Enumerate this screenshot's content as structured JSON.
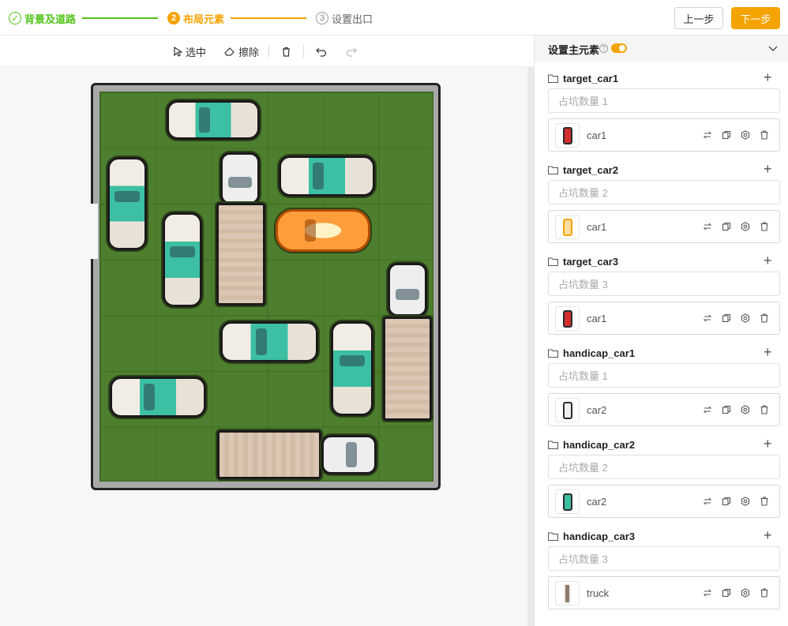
{
  "stepper": {
    "steps": [
      {
        "num": "✓",
        "label": "背景及道路"
      },
      {
        "num": "2",
        "label": "布局元素"
      },
      {
        "num": "3",
        "label": "设置出口"
      }
    ],
    "prev_label": "上一步",
    "next_label": "下一步"
  },
  "toolbar": {
    "select_label": "选中",
    "erase_label": "擦除"
  },
  "panel": {
    "title": "设置主元素",
    "groups": [
      {
        "name": "target_car1",
        "placeholder": "占坑数量 1",
        "item": "car1"
      },
      {
        "name": "target_car2",
        "placeholder": "占坑数量 2",
        "item": "car1"
      },
      {
        "name": "target_car3",
        "placeholder": "占坑数量 3",
        "item": "car1"
      },
      {
        "name": "handicap_car1",
        "placeholder": "占坑数量 1",
        "item": "car2"
      },
      {
        "name": "handicap_car2",
        "placeholder": "占坑数量 2",
        "item": "car2"
      },
      {
        "name": "handicap_car3",
        "placeholder": "占坑数量 3",
        "item": "truck"
      }
    ]
  },
  "colors": {
    "accent": "#f5a300",
    "done": "#52c41a",
    "grass": "#4d7f2e"
  }
}
